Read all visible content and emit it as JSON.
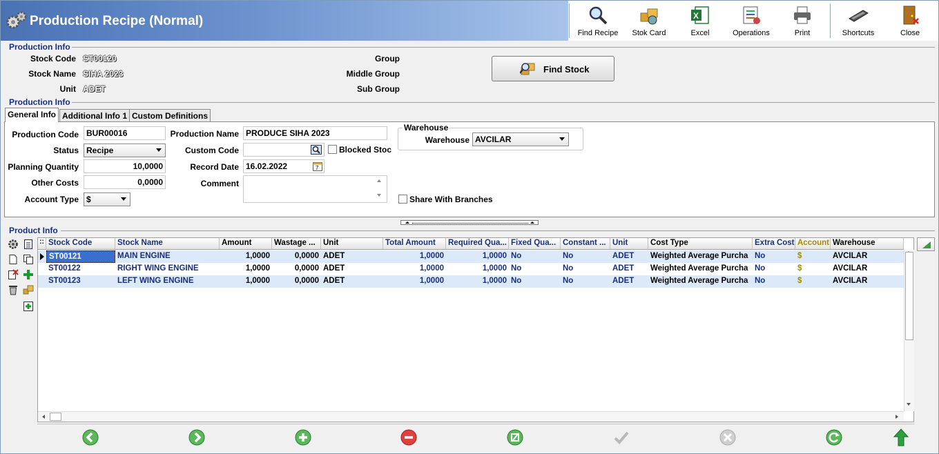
{
  "window": {
    "title": "Production Recipe (Normal)"
  },
  "toolbar": {
    "find_recipe": "Find Recipe",
    "stok_card": "Stok Card",
    "excel": "Excel",
    "operations": "Operations",
    "print": "Print",
    "shortcuts": "Shortcuts",
    "close": "Close"
  },
  "production_info": {
    "title": "Production Info",
    "stock_code_label": "Stock Code",
    "stock_code": "ST00120",
    "stock_name_label": "Stock Name",
    "stock_name": "SIHA 2023",
    "unit_label": "Unit",
    "unit": "ADET",
    "group_label": "Group",
    "middle_group_label": "Middle Group",
    "sub_group_label": "Sub Group",
    "find_stock_label": "Find Stock"
  },
  "production_info2": {
    "title": "Production Info"
  },
  "tabs": [
    {
      "label": "General Info"
    },
    {
      "label": "Additional Info 1"
    },
    {
      "label": "Custom Definitions"
    }
  ],
  "general": {
    "production_code_label": "Production Code",
    "production_code": "BUR00016",
    "status_label": "Status",
    "status": "Recipe",
    "planning_quantity_label": "Planning Quantity",
    "planning_quantity": "10,0000",
    "other_costs_label": "Other Costs",
    "other_costs": "0,0000",
    "account_type_label": "Account Type",
    "account_type": "$",
    "production_name_label": "Production Name",
    "production_name": "PRODUCE SIHA 2023",
    "custom_code_label": "Custom Code",
    "custom_code": "",
    "blocked_stock_label": "Blocked Stock",
    "record_date_label": "Record Date",
    "record_date": "16.02.2022",
    "comment_label": "Comment",
    "comment": "",
    "warehouse_group_label": "Warehouse",
    "warehouse_label": "Warehouse",
    "warehouse": "AVCILAR",
    "share_branches_label": "Share With Branches"
  },
  "product_info": {
    "title": "Product Info",
    "columns": [
      "Stock Code",
      "Stock Name",
      "Amount",
      "Wastage ...",
      "Unit",
      "Total Amount",
      "Required Qua...",
      "Fixed Qua...",
      "Constant ...",
      "Unit",
      "Cost Type",
      "Extra Cost",
      "Account",
      "Warehouse"
    ],
    "rows": [
      [
        "ST00121",
        "MAIN ENGINE",
        "1,0000",
        "0,0000",
        "ADET",
        "1,0000",
        "1,0000",
        "No",
        "No",
        "ADET",
        "Weighted Average Purcha",
        "No",
        "$",
        "AVCILAR"
      ],
      [
        "ST00122",
        "RIGHT WING ENGINE",
        "1,0000",
        "0,0000",
        "ADET",
        "1,0000",
        "1,0000",
        "No",
        "No",
        "ADET",
        "Weighted Average Purcha",
        "No",
        "$",
        "AVCILAR"
      ],
      [
        "ST00123",
        "LEFT WING ENGINE",
        "1,0000",
        "0,0000",
        "ADET",
        "1,0000",
        "1,0000",
        "No",
        "No",
        "ADET",
        "Weighted Average Purcha",
        "No",
        "$",
        "AVCILAR"
      ]
    ]
  },
  "colors": {
    "accent": "#1a2f7a",
    "selected_row": "#dbe9f9",
    "header_gradient_start": "#4a72b3"
  }
}
